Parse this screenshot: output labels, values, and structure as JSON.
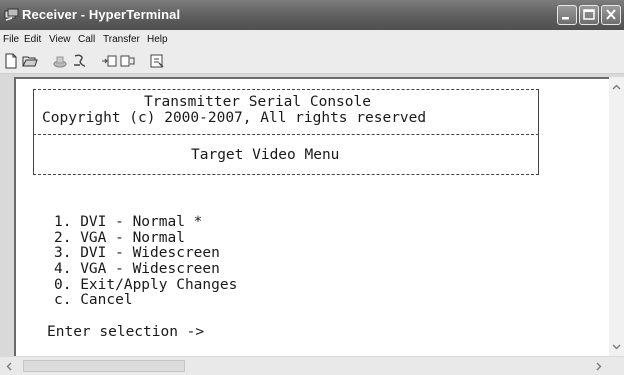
{
  "window": {
    "title": "Receiver - HyperTerminal"
  },
  "menu": [
    "File",
    "Edit",
    "View",
    "Call",
    "Transfer",
    "Help"
  ],
  "toolbar": {
    "icons": [
      "new-connection-icon",
      "open-icon",
      "dial-icon",
      "disconnect-icon",
      "send-icon",
      "receive-icon",
      "properties-icon"
    ]
  },
  "terminal": {
    "header_line1": "Transmitter Serial Console",
    "header_line2": "Copyright (c) 2000-2007, All rights reserved",
    "menu_title": "Target Video Menu",
    "options": [
      "1. DVI - Normal *",
      "2. VGA - Normal",
      "3. DVI - Widescreen",
      "4. VGA - Widescreen",
      "0. Exit/Apply Changes",
      "c. Cancel"
    ],
    "prompt": "Enter selection ->"
  }
}
